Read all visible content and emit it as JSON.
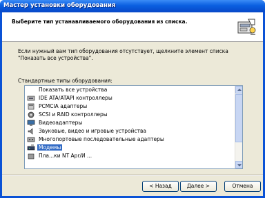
{
  "window": {
    "title": "Мастер установки оборудования"
  },
  "header": {
    "title": "Выберите тип устанавливаемого оборудования из списка.",
    "icon": "hardware-wizard-icon"
  },
  "description": "Если нужный вам тип оборудования отсутствует, щелкните элемент списка\n\"Показать все устройства\".",
  "list_label": "Стандартные типы оборудования:",
  "device_types": [
    {
      "label": "Показать все устройства",
      "icon": "",
      "selected": false
    },
    {
      "label": "IDE ATA/ATAPI контроллеры",
      "icon": "ide-controller-icon",
      "selected": false
    },
    {
      "label": "PCMCIA адаптеры",
      "icon": "pcmcia-adapter-icon",
      "selected": false
    },
    {
      "label": "SCSI и RAID контроллеры",
      "icon": "scsi-controller-icon",
      "selected": false
    },
    {
      "label": "Видеоадаптеры",
      "icon": "display-adapter-icon",
      "selected": false
    },
    {
      "label": "Звуковые, видео и игровые устройства",
      "icon": "sound-device-icon",
      "selected": false
    },
    {
      "label": "Многопортовые последовательные адаптеры",
      "icon": "multiport-serial-icon",
      "selected": false
    },
    {
      "label": "Модемы",
      "icon": "modem-icon",
      "selected": true
    },
    {
      "label": "Пла...ки NT Apr/И ...",
      "icon": "partial-item-icon",
      "selected": false
    }
  ],
  "buttons": {
    "back": "< Назад",
    "next": "Далее >",
    "cancel": "Отмена"
  },
  "colors": {
    "titlebar": "#0a5fe0",
    "selection": "#316ac5",
    "dialog_bg": "#ece9d8"
  }
}
